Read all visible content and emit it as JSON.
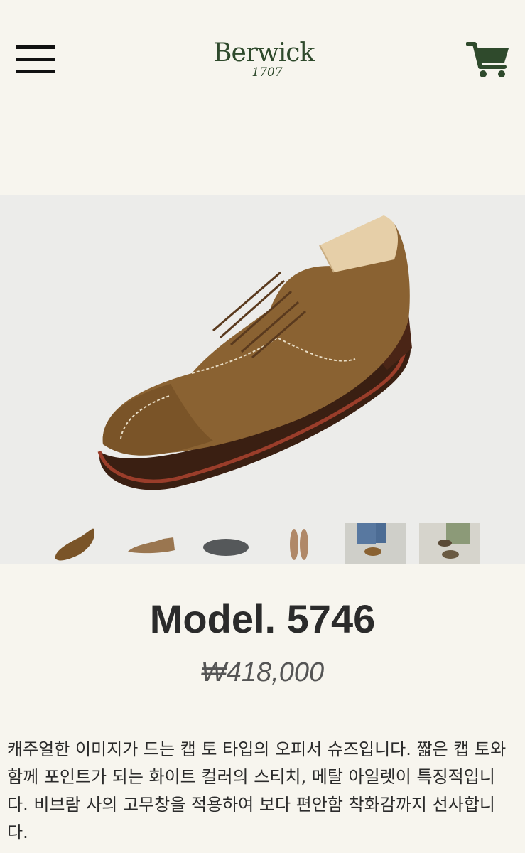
{
  "header": {
    "brand": "Berwick",
    "brand_year": "1707"
  },
  "product": {
    "model": "Model. 5746",
    "price": "₩418,000",
    "description": " 캐주얼한 이미지가 드는 캡 토 타입의 오피서 슈즈입니다. 짧은 캡 토와 함께 포인트가 되는 화이트 컬러의 스티치, 메탈 아일렛이 특징적입니다. 비브람 사의 고무창을 적용하여 보다 편안함 착화감까지 선사합니다."
  },
  "gallery": {
    "thumbnail_count": 6,
    "selected_index": 0
  },
  "colors": {
    "brand_green": "#2f4a2c",
    "page_bg": "#f7f5ee",
    "hero_bg": "#ececea",
    "suede": "#8a6232"
  }
}
